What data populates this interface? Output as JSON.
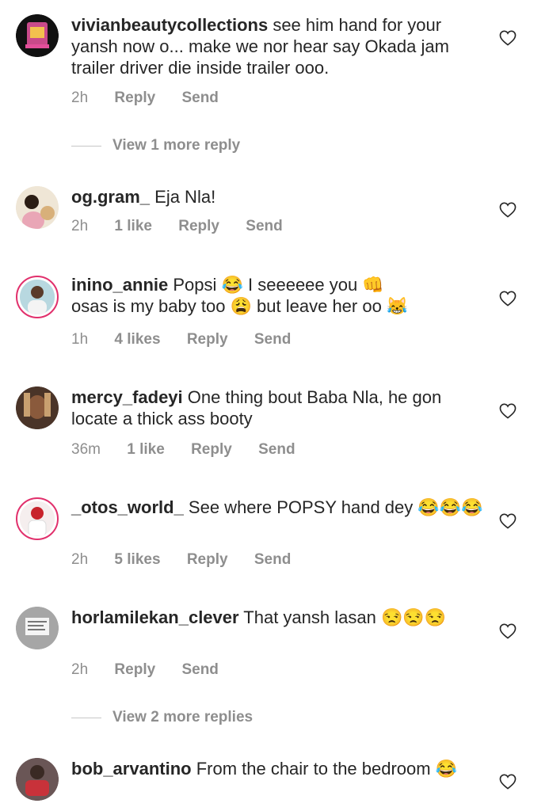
{
  "comments": [
    {
      "username": "vivianbeautycollections",
      "text": " see him hand for your yansh now o... make we nor hear say Okada jam trailer driver die inside trailer ooo.",
      "time": "2h",
      "likes": "",
      "reply": "Reply",
      "send": "Send",
      "view_more": "View 1 more reply"
    },
    {
      "username": "og.gram_",
      "text": " Eja Nla!",
      "time": "2h",
      "likes": "1 like",
      "reply": "Reply",
      "send": "Send"
    },
    {
      "username": "inino_annie",
      "text_lines": [
        " Popsi 😂 I seeeeee you 👊",
        "osas is my baby too 😩 but leave her oo 😹"
      ],
      "time": "1h",
      "likes": "4 likes",
      "reply": "Reply",
      "send": "Send"
    },
    {
      "username": "mercy_fadeyi",
      "text": " One thing bout Baba Nla, he gon locate a thick ass booty",
      "time": "36m",
      "likes": "1 like",
      "reply": "Reply",
      "send": "Send"
    },
    {
      "username": "_otos_world_",
      "text": " See where POPSY hand dey 😂😂😂",
      "time": "2h",
      "likes": "5 likes",
      "reply": "Reply",
      "send": "Send"
    },
    {
      "username": "horlamilekan_clever",
      "text": " That yansh lasan 😒😒😒",
      "time": "2h",
      "likes": "",
      "reply": "Reply",
      "send": "Send",
      "view_more": "View 2 more replies"
    },
    {
      "username": "bob_arvantino",
      "text": " From the chair to the bedroom 😂"
    }
  ],
  "icons": {
    "like": "heart-outline-icon"
  },
  "colors": {
    "meta": "#8e8e8e",
    "text": "#262626",
    "story_ring": "#e1306c"
  }
}
